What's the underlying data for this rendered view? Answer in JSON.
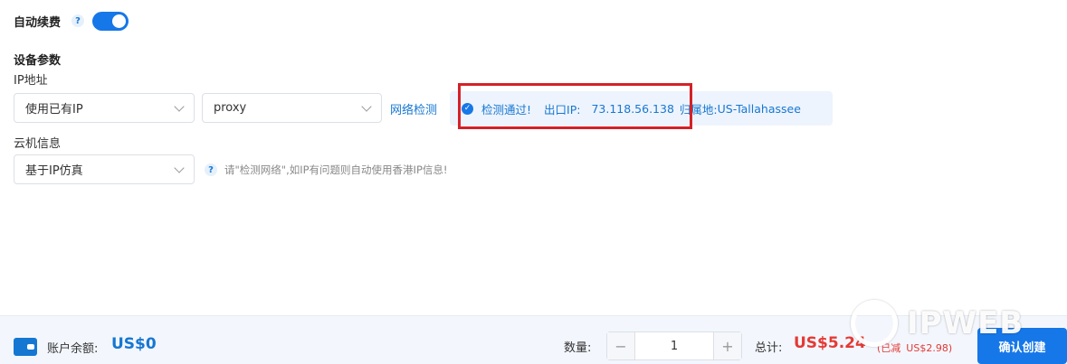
{
  "auto_renew": {
    "label": "自动续费",
    "help": "?",
    "enabled": true
  },
  "device_params": {
    "title": "设备参数",
    "ip_label": "IP地址",
    "ip_mode_select": "使用已有IP",
    "proxy_select": "proxy",
    "network_check_link": "网络检测",
    "result": {
      "status": "检测通过!",
      "egress_label": "出口IP:",
      "egress_ip": "73.118.56.138",
      "region_label": "归属地:",
      "region": "US-Tallahassee"
    },
    "cloud_info_label": "云机信息",
    "cloud_info_select": "基于IP仿真",
    "hint_help": "?",
    "hint": "请\"检测网络\",如IP有问题则自动使用香港IP信息!"
  },
  "footer": {
    "balance_label": "账户余额:",
    "balance_value": "US$0",
    "quantity_label": "数量:",
    "quantity_value": "1",
    "minus": "−",
    "plus": "+",
    "total_label": "总计:",
    "total_value": "US$5.24",
    "discount_label": "(已减",
    "discount_value": "US$2.98)",
    "create_button": "确认创建"
  },
  "watermark": {
    "text": "IPWEB"
  },
  "colors": {
    "accent": "#1677e8",
    "price": "#e53935",
    "highlight_box": "#d42128"
  },
  "icons": {
    "help": "question-circle-icon",
    "check": "check-circle-icon",
    "wallet": "wallet-icon"
  }
}
